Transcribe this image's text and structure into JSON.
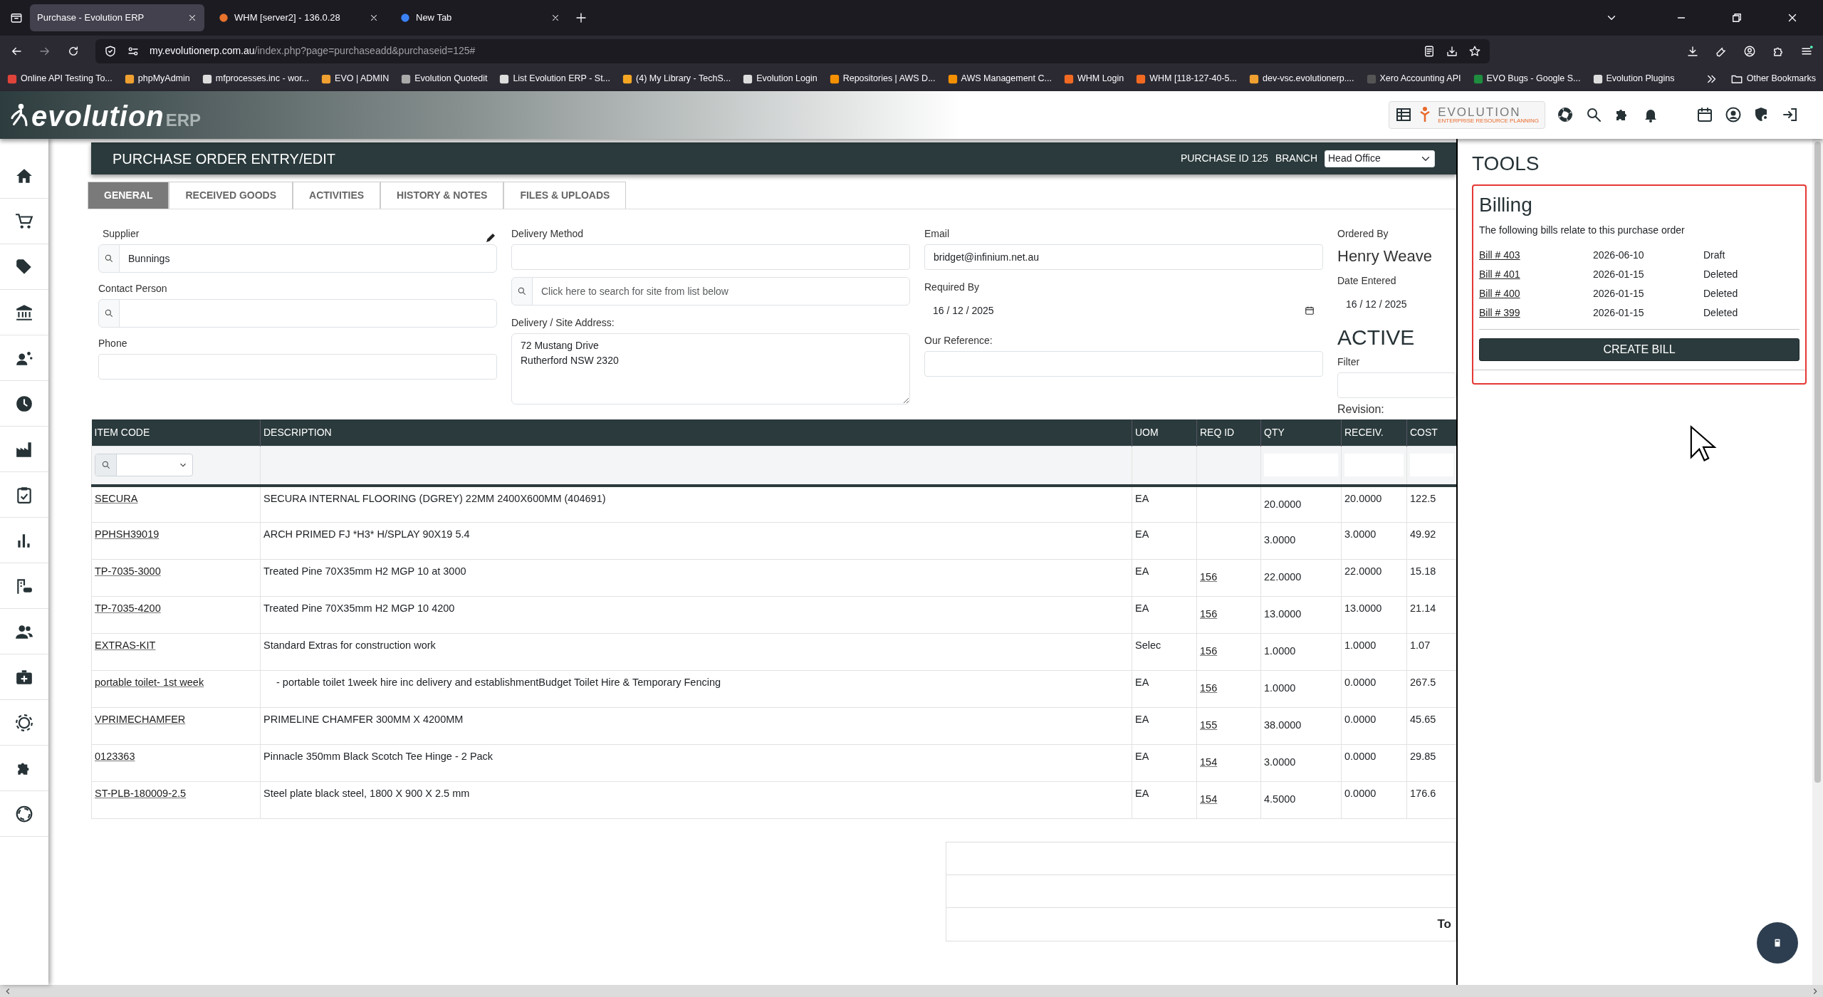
{
  "browser": {
    "tabs": [
      {
        "title": "Purchase - Evolution ERP",
        "selected": true
      },
      {
        "title": "WHM [server2] - 136.0.28",
        "selected": false
      },
      {
        "title": "New Tab",
        "selected": false
      }
    ],
    "url_host": "my.evolutionerp.com.au",
    "url_path": "/index.php?page=purchaseadd&purchaseid=125#",
    "bookmarks": [
      "Online API Testing To...",
      "phpMyAdmin",
      "mfprocesses.inc - wor...",
      "EVO | ADMIN",
      "Evolution Quotedit",
      "List Evolution ERP - St...",
      "(4) My Library - TechS...",
      "Evolution Login",
      "Repositories | AWS D...",
      "AWS Management C...",
      "WHM Login",
      "WHM [118-127-40-5...",
      "dev-vsc.evolutionerp....",
      "Xero Accounting API",
      "EVO Bugs - Google S...",
      "Evolution Plugins"
    ],
    "other_bookmarks": "Other Bookmarks"
  },
  "app": {
    "logo_word": "evolution",
    "logo_suffix": "ERP",
    "brand_title": "EVOLUTION",
    "brand_subtitle": "ENTERPRISE RESOURCE PLANNING"
  },
  "page": {
    "title": "PURCHASE ORDER ENTRY/EDIT",
    "purchase_id": "PURCHASE ID 125",
    "branch_label": "BRANCH",
    "branch_value": "Head Office"
  },
  "tabs": [
    {
      "label": "GENERAL",
      "selected": true
    },
    {
      "label": "RECEIVED GOODS",
      "selected": false
    },
    {
      "label": "ACTIVITIES",
      "selected": false
    },
    {
      "label": "HISTORY & NOTES",
      "selected": false
    },
    {
      "label": "FILES & UPLOADS",
      "selected": false
    }
  ],
  "form": {
    "supplier": {
      "label": "Supplier",
      "value": "Bunnings"
    },
    "contact_person": {
      "label": "Contact Person"
    },
    "phone": {
      "label": "Phone"
    },
    "delivery_method": {
      "label": "Delivery Method"
    },
    "site_search": {
      "placeholder": "Click here to search for site from list below"
    },
    "delivery_address": {
      "label": "Delivery / Site Address:",
      "value": "72 Mustang Drive\nRutherford NSW 2320"
    },
    "email": {
      "label": "Email",
      "value": "bridget@infinium.net.au"
    },
    "required_by": {
      "label": "Required By",
      "value": "16 / 12 / 2025"
    },
    "our_reference": {
      "label": "Our Reference:"
    },
    "ordered_by": {
      "label": "Ordered By",
      "value": "Henry Weave"
    },
    "date_entered": {
      "label": "Date Entered",
      "value": "16 / 12 / 2025"
    },
    "status": "ACTIVE",
    "filter": {
      "label": "Filter"
    },
    "revision": {
      "label": "Revision:"
    }
  },
  "table": {
    "columns": [
      "ITEM CODE",
      "DESCRIPTION",
      "UOM",
      "REQ ID",
      "QTY",
      "RECEIV.",
      "COST"
    ],
    "rows": [
      [
        "SECURA",
        "SECURA INTERNAL FLOORING (DGREY) 22MM 2400X600MM (404691)",
        "EA",
        "",
        "20.0000",
        "20.0000",
        "122.5"
      ],
      [
        "PPHSH39019",
        "ARCH PRIMED FJ *H3* H/SPLAY 90X19 5.4",
        "EA",
        "",
        "3.0000",
        "3.0000",
        "49.92"
      ],
      [
        "TP-7035-3000",
        "Treated Pine 70X35mm H2 MGP 10 at 3000",
        "EA",
        "156",
        "22.0000",
        "22.0000",
        "15.18"
      ],
      [
        "TP-7035-4200",
        "Treated Pine 70X35mm H2 MGP 10 4200",
        "EA",
        "156",
        "13.0000",
        "13.0000",
        "21.14"
      ],
      [
        "EXTRAS-KIT",
        "Standard Extras for construction work",
        "Selec",
        "156",
        "1.0000",
        "1.0000",
        "1.07"
      ],
      [
        "portable toilet- 1st week",
        "- portable toilet 1week hire inc delivery and establishmentBudget Toilet Hire & Temporary Fencing",
        "EA",
        "156",
        "1.0000",
        "0.0000",
        "267.5"
      ],
      [
        "VPRIMECHAMFER",
        "PRIMELINE CHAMFER 300MM X 4200MM",
        "EA",
        "155",
        "38.0000",
        "0.0000",
        "45.65"
      ],
      [
        "0123363",
        "Pinnacle 350mm Black Scotch Tee Hinge - 2 Pack",
        "EA",
        "154",
        "3.0000",
        "0.0000",
        "29.85"
      ],
      [
        "ST-PLB-180009-2.5",
        "Steel plate black steel, 1800 X 900 X 2.5 mm",
        "EA",
        "154",
        "4.5000",
        "0.0000",
        "176.6"
      ]
    ]
  },
  "totals": {
    "label": "To"
  },
  "tools": {
    "title": "TOOLS",
    "billing": {
      "title": "Billing",
      "intro": "The following bills relate to this purchase order",
      "bills": [
        {
          "link": "Bill # 403",
          "date": "2026-06-10",
          "status": "Draft"
        },
        {
          "link": "Bill # 401",
          "date": "2026-01-15",
          "status": "Deleted"
        },
        {
          "link": "Bill # 400",
          "date": "2026-01-15",
          "status": "Deleted"
        },
        {
          "link": "Bill # 399",
          "date": "2026-01-15",
          "status": "Deleted"
        }
      ],
      "button": "CREATE BILL"
    }
  }
}
